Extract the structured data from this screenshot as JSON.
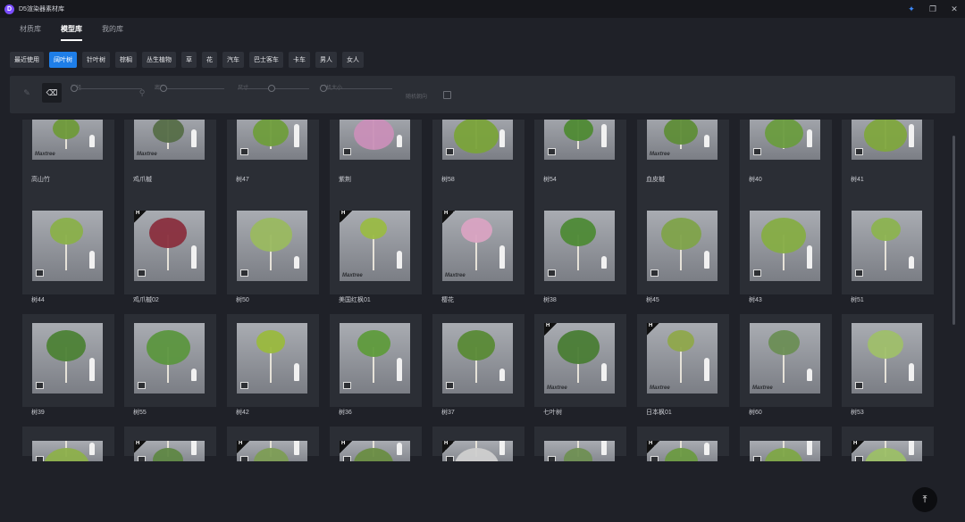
{
  "app": {
    "title": "D5渲染器素材库"
  },
  "window_controls": {
    "pin_icon": "pin-icon",
    "restore_icon": "restore-icon",
    "close_icon": "close-icon"
  },
  "tabs": [
    {
      "label": "材质库",
      "active": false
    },
    {
      "label": "模型库",
      "active": true
    },
    {
      "label": "我的库",
      "active": false
    }
  ],
  "categories": [
    {
      "label": "最近使用",
      "active": false
    },
    {
      "label": "阔叶树",
      "active": true
    },
    {
      "label": "针叶树",
      "active": false
    },
    {
      "label": "棕榈",
      "active": false
    },
    {
      "label": "丛生植物",
      "active": false
    },
    {
      "label": "草",
      "active": false
    },
    {
      "label": "花",
      "active": false
    },
    {
      "label": "汽车",
      "active": false
    },
    {
      "label": "巴士客车",
      "active": false
    },
    {
      "label": "卡车",
      "active": false
    },
    {
      "label": "男人",
      "active": false
    },
    {
      "label": "女人",
      "active": false
    }
  ],
  "toolbar": {
    "brush_icon": "brush-icon",
    "eraser_icon": "eraser-icon",
    "dropper_icon": "dropper-icon",
    "sliders": [
      {
        "label": "半径"
      },
      {
        "label": "密度"
      },
      {
        "label": "尺寸"
      },
      {
        "label": "随机大小"
      }
    ],
    "checkbox_label": "随机朝向"
  },
  "assets": [
    [
      {
        "name": "高山竹",
        "h": false,
        "brand": "Maxtree",
        "color": "#6f9a3a"
      },
      {
        "name": "鸡爪槭",
        "h": false,
        "brand": "Maxtree",
        "color": "#566e48"
      },
      {
        "name": "树47",
        "h": false,
        "brand": "",
        "color": "#6f9d3c"
      },
      {
        "name": "紫荆",
        "h": false,
        "brand": "",
        "color": "#c98fb8"
      },
      {
        "name": "树58",
        "h": false,
        "brand": "",
        "color": "#7aa33a"
      },
      {
        "name": "树54",
        "h": false,
        "brand": "",
        "color": "#4f8a34"
      },
      {
        "name": "血皮槭",
        "h": false,
        "brand": "Maxtree",
        "color": "#5f8d38"
      },
      {
        "name": "树40",
        "h": false,
        "brand": "",
        "color": "#6a9c3f"
      },
      {
        "name": "树41",
        "h": false,
        "brand": "",
        "color": "#7fa73e"
      }
    ],
    [
      {
        "name": "树44",
        "h": false,
        "brand": "",
        "color": "#8ab04a"
      },
      {
        "name": "鸡爪槭02",
        "h": true,
        "brand": "",
        "color": "#8a2f3e"
      },
      {
        "name": "树50",
        "h": false,
        "brand": "",
        "color": "#9ab960"
      },
      {
        "name": "美国红枫01",
        "h": true,
        "brand": "Maxtree",
        "color": "#9aba45"
      },
      {
        "name": "樱花",
        "h": true,
        "brand": "Maxtree",
        "color": "#d9a3c2"
      },
      {
        "name": "树38",
        "h": false,
        "brand": "",
        "color": "#4e8a36"
      },
      {
        "name": "树45",
        "h": false,
        "brand": "",
        "color": "#7fa34a"
      },
      {
        "name": "树43",
        "h": false,
        "brand": "",
        "color": "#86ad45"
      },
      {
        "name": "树51",
        "h": false,
        "brand": "",
        "color": "#8cb350"
      }
    ],
    [
      {
        "name": "树39",
        "h": false,
        "brand": "",
        "color": "#4d8236"
      },
      {
        "name": "树55",
        "h": false,
        "brand": "",
        "color": "#5c963f"
      },
      {
        "name": "树42",
        "h": false,
        "brand": "",
        "color": "#9ab93e"
      },
      {
        "name": "树36",
        "h": false,
        "brand": "",
        "color": "#5f9b3c"
      },
      {
        "name": "树37",
        "h": false,
        "brand": "",
        "color": "#5a8a36"
      },
      {
        "name": "七叶树",
        "h": true,
        "brand": "Maxtree",
        "color": "#4a7d35"
      },
      {
        "name": "日本枫01",
        "h": true,
        "brand": "Maxtree",
        "color": "#8fa84b"
      },
      {
        "name": "树60",
        "h": false,
        "brand": "Maxtree",
        "color": "#6c8e55"
      },
      {
        "name": "树53",
        "h": false,
        "brand": "",
        "color": "#9fbf6a"
      }
    ],
    [
      {
        "name": "",
        "h": false,
        "brand": "",
        "color": "#8db04b"
      },
      {
        "name": "",
        "h": true,
        "brand": "",
        "color": "#5f8745"
      },
      {
        "name": "",
        "h": true,
        "brand": "",
        "color": "#7d9d55"
      },
      {
        "name": "",
        "h": true,
        "brand": "",
        "color": "#6a8d43"
      },
      {
        "name": "",
        "h": true,
        "brand": "",
        "color": "#cfcfcf"
      },
      {
        "name": "",
        "h": false,
        "brand": "",
        "color": "#6f8f53"
      },
      {
        "name": "",
        "h": true,
        "brand": "",
        "color": "#6c9a42"
      },
      {
        "name": "",
        "h": false,
        "brand": "",
        "color": "#7ea647"
      },
      {
        "name": "",
        "h": true,
        "brand": "",
        "color": "#9cbf67"
      }
    ]
  ],
  "back_to_top_icon": "arrow-up-to-line-icon"
}
